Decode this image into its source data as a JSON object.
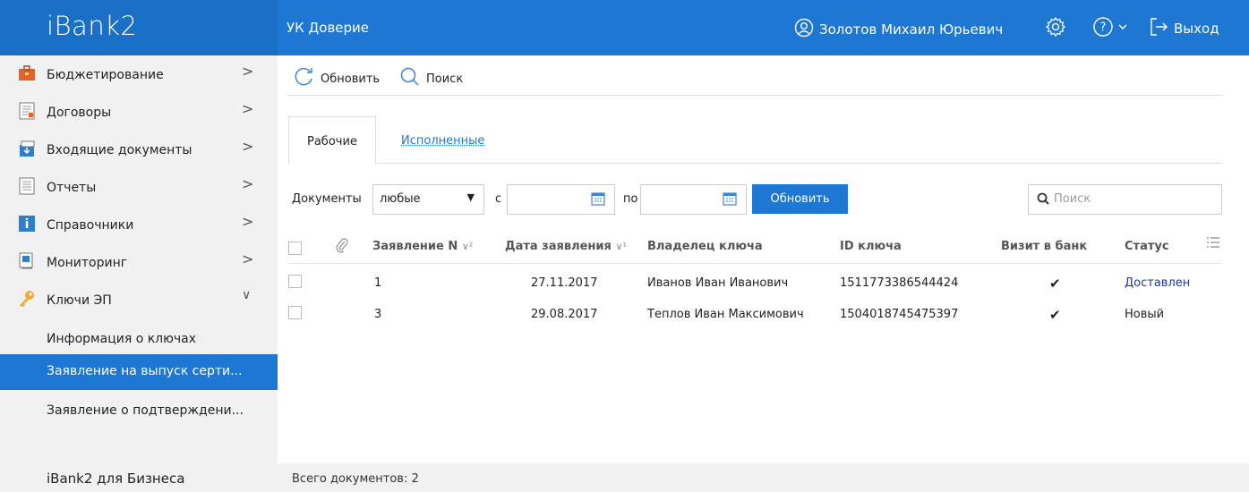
{
  "app": {
    "logo": "iBank2",
    "org": "УК Доверие",
    "user": "Золотов Михаил Юрьевич",
    "logout": "Выход"
  },
  "sidebar": {
    "items": [
      {
        "label": "Бюджетирование",
        "icon": "briefcase-icon"
      },
      {
        "label": "Договоры",
        "icon": "contract-icon"
      },
      {
        "label": "Входящие документы",
        "icon": "inbox-icon"
      },
      {
        "label": "Отчеты",
        "icon": "report-icon"
      },
      {
        "label": "Справочники",
        "icon": "info-icon"
      },
      {
        "label": "Мониторинг",
        "icon": "monitor-icon"
      },
      {
        "label": "Ключи ЭП",
        "icon": "key-icon"
      }
    ],
    "subitems": [
      {
        "label": "Информация о ключах"
      },
      {
        "label": "Заявление на выпуск серти..."
      },
      {
        "label": "Заявление о подтверждени..."
      }
    ]
  },
  "toolbar": {
    "refresh": "Обновить",
    "search": "Поиск"
  },
  "tabs": {
    "active": "Рабочие",
    "other": "Исполненные"
  },
  "filter": {
    "docs_label": "Документы",
    "docs_value": "любые",
    "from_label": "с",
    "to_label": "по",
    "refresh_button": "Обновить",
    "search_placeholder": "Поиск"
  },
  "table": {
    "headers": {
      "number": "Заявление N",
      "number_sort": "∨²",
      "date": "Дата заявления",
      "date_sort": "∨¹",
      "owner": "Владелец ключа",
      "key_id": "ID ключа",
      "visit": "Визит в банк",
      "status": "Статус"
    },
    "rows": [
      {
        "number": "1",
        "date": "27.11.2017",
        "owner": "Иванов Иван Иванович",
        "key_id": "1511773386544424",
        "visit": "✔",
        "status": "Доставлен"
      },
      {
        "number": "3",
        "date": "29.08.2017",
        "owner": "Теплов Иван Максимович",
        "key_id": "1504018745475397",
        "visit": "✔",
        "status": "Новый"
      }
    ]
  },
  "footer": {
    "left": "iBank2 для Бизнеса",
    "total": "Всего документов: 2"
  },
  "colors": {
    "primary": "#1e77d3",
    "status_delivered": "#1a3a9c"
  }
}
